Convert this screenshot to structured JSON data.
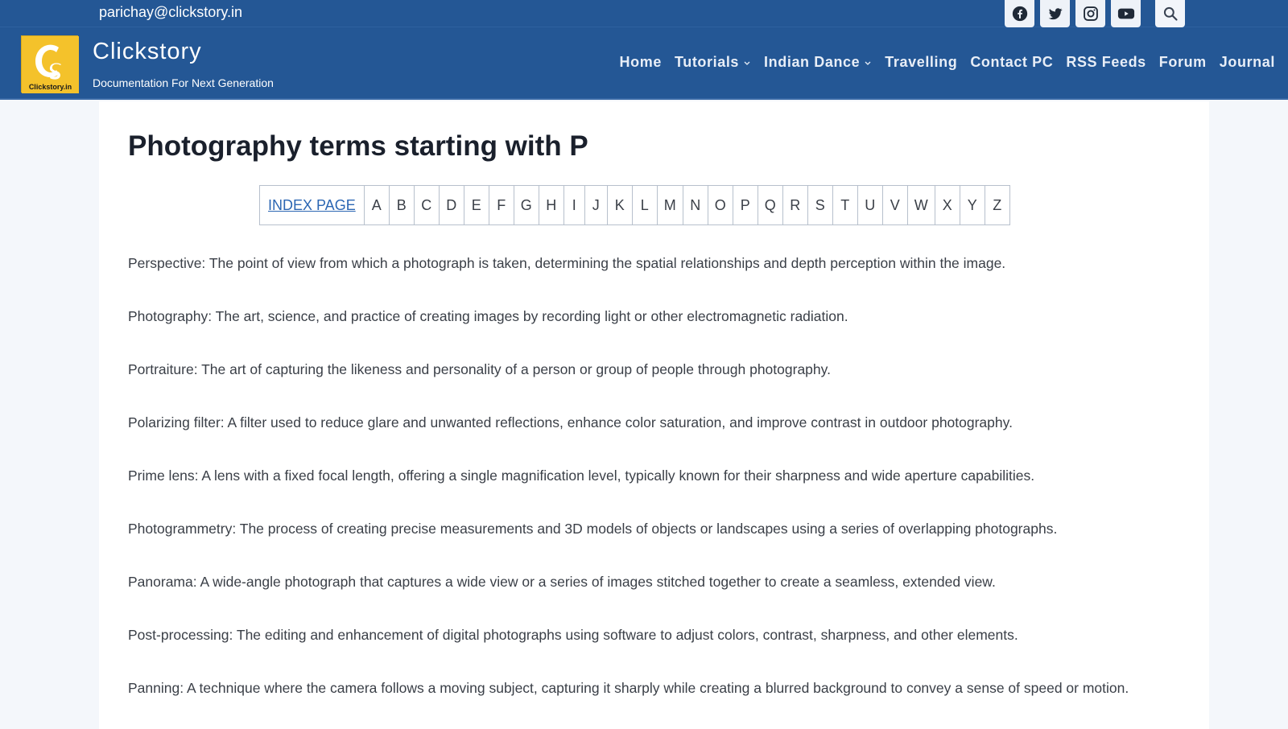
{
  "topbar": {
    "email": "parichay@clickstory.in",
    "social": [
      {
        "name": "facebook",
        "icon": "facebook-icon"
      },
      {
        "name": "twitter",
        "icon": "twitter-icon"
      },
      {
        "name": "instagram",
        "icon": "instagram-icon"
      },
      {
        "name": "youtube",
        "icon": "youtube-icon"
      }
    ],
    "search_icon": "search-icon"
  },
  "header": {
    "logo_text": "Clickstory.in",
    "brand_title": "Clickstory",
    "brand_tagline": "Documentation For Next Generation",
    "colors": {
      "primary": "#245795",
      "logo_bg": "#f4c22b",
      "link": "#2b66b3"
    }
  },
  "nav": {
    "items": [
      {
        "label": "Home",
        "dropdown": false
      },
      {
        "label": "Tutorials",
        "dropdown": true
      },
      {
        "label": "Indian Dance",
        "dropdown": true
      },
      {
        "label": "Travelling",
        "dropdown": false
      },
      {
        "label": "Contact PC",
        "dropdown": false
      },
      {
        "label": "RSS Feeds",
        "dropdown": false
      },
      {
        "label": "Forum",
        "dropdown": false
      },
      {
        "label": "Journal",
        "dropdown": false
      }
    ]
  },
  "main": {
    "title": "Photography terms starting with P",
    "alphabet_nav": {
      "index_label": "INDEX PAGE",
      "letters": [
        "A",
        "B",
        "C",
        "D",
        "E",
        "F",
        "G",
        "H",
        "I",
        "J",
        "K",
        "L",
        "M",
        "N",
        "O",
        "P",
        "Q",
        "R",
        "S",
        "T",
        "U",
        "V",
        "W",
        "X",
        "Y",
        "Z"
      ]
    },
    "terms": [
      "Perspective: The point of view from which a photograph is taken, determining the spatial relationships and depth perception within the image.",
      "Photography: The art, science, and practice of creating images by recording light or other electromagnetic radiation.",
      "Portraiture: The art of capturing the likeness and personality of a person or group of people through photography.",
      "Polarizing filter: A filter used to reduce glare and unwanted reflections, enhance color saturation, and improve contrast in outdoor photography.",
      "Prime lens: A lens with a fixed focal length, offering a single magnification level, typically known for their sharpness and wide aperture capabilities.",
      "Photogrammetry: The process of creating precise measurements and 3D models of objects or landscapes using a series of overlapping photographs.",
      "Panorama: A wide-angle photograph that captures a wide view or a series of images stitched together to create a seamless, extended view.",
      "Post-processing: The editing and enhancement of digital photographs using software to adjust colors, contrast, sharpness, and other elements.",
      "Panning: A technique where the camera follows a moving subject, capturing it sharply while creating a blurred background to convey a sense of speed or motion."
    ]
  }
}
